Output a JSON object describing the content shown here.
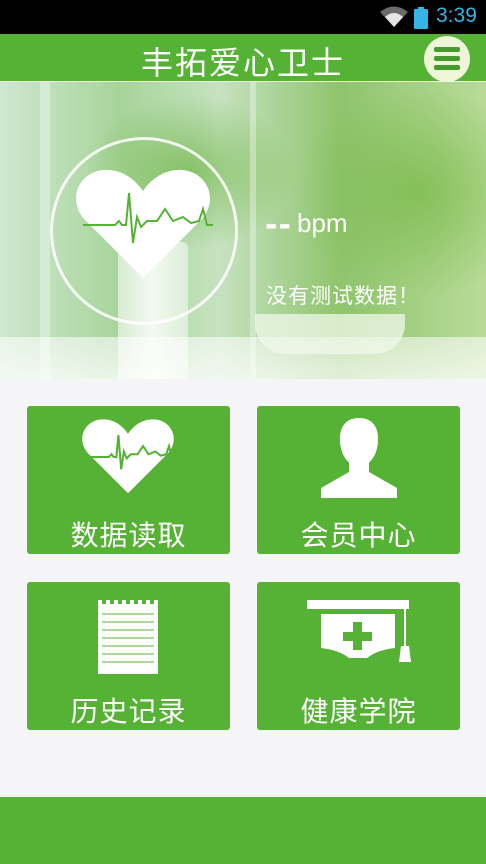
{
  "status_bar": {
    "time": "3:39",
    "wifi_icon": "wifi-icon",
    "battery_icon": "battery-icon",
    "accent_color": "#35b5e5"
  },
  "header": {
    "title": "丰拓爱心卫士",
    "menu_icon": "hamburger-menu-icon",
    "brand_color": "#55b234"
  },
  "banner": {
    "heart_icon": "heart-pulse-icon",
    "bpm_value": "--",
    "bpm_unit": "bpm",
    "status_message": "没有测试数据！"
  },
  "tiles": [
    {
      "label": "数据读取",
      "icon": "heart-pulse-icon"
    },
    {
      "label": "会员中心",
      "icon": "user-silhouette-icon"
    },
    {
      "label": "历史记录",
      "icon": "notepad-icon"
    },
    {
      "label": "健康学院",
      "icon": "graduation-cap-icon"
    }
  ]
}
